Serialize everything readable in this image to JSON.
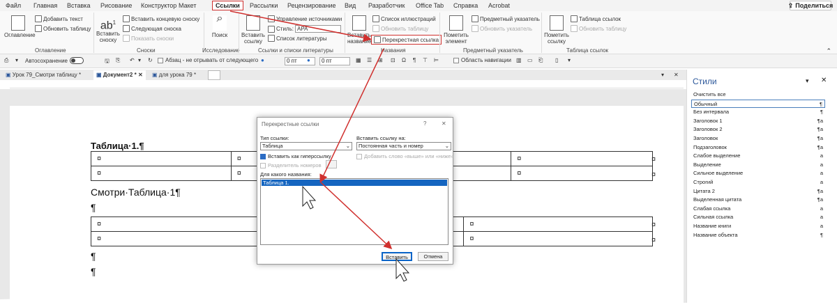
{
  "menu": {
    "tabs": [
      "Файл",
      "Главная",
      "Вставка",
      "Рисование",
      "Конструктор",
      "Макет",
      "Ссылки",
      "Рассылки",
      "Рецензирование",
      "Вид",
      "Разработчик",
      "Office Tab",
      "Справка",
      "Acrobat"
    ],
    "active_tab": "Ссылки",
    "share": "Поделиться"
  },
  "ribbon": {
    "toc": {
      "big": "Оглавление",
      "add_text": "Добавить текст",
      "update": "Обновить таблицу",
      "group": "Оглавление"
    },
    "footnotes": {
      "big1": "Вставить",
      "big2": "сноску",
      "insert_end": "Вставить концевую сноску",
      "next": "Следующая сноска",
      "show": "Показать сноски",
      "group": "Сноски",
      "ab": "ab",
      "sup": "1"
    },
    "research": {
      "big": "Поиск",
      "group": "Исследование"
    },
    "citations": {
      "big1": "Вставить",
      "big2": "ссылку",
      "manage": "Управление источниками",
      "style_label": "Стиль:",
      "style_value": "APA",
      "biblio": "Список литературы",
      "group": "Ссылки и списки литературы"
    },
    "captions": {
      "big1": "Вставить",
      "big2": "название",
      "list_fig": "Список иллюстраций",
      "update": "Обновить таблицу",
      "xref": "Перекрестная ссылка",
      "group": "Названия"
    },
    "index": {
      "big1": "Пометить",
      "big2": "элемент",
      "subject": "Предметный указатель",
      "update": "Обновить указатель",
      "group": "Предметный указатель"
    },
    "toa": {
      "big1": "Пометить",
      "big2": "ссылку",
      "table": "Таблица ссылок",
      "update": "Обновить таблицу",
      "group": "Таблица ссылок"
    }
  },
  "qat": {
    "autosave": "Автосохранение",
    "keep": "Абзац - не отрывать от следующего",
    "spin1": "0 пт",
    "spin2": "0 пт",
    "nav": "Область навигации"
  },
  "doc_tabs": [
    "Урок 79_Смотри таблицу *",
    "Документ2 *",
    "для урока 79 *"
  ],
  "document": {
    "caption": "Таблица·1.¶",
    "ref_line": "Смотри·Таблица·1¶",
    "para": "¶",
    "cell": "¤"
  },
  "styles": {
    "title": "Стили",
    "items": [
      {
        "name": "Очистить все",
        "mark": ""
      },
      {
        "name": "Обычный",
        "mark": "¶"
      },
      {
        "name": "Без интервала",
        "mark": "¶"
      },
      {
        "name": "Заголовок 1",
        "mark": "¶a"
      },
      {
        "name": "Заголовок 2",
        "mark": "¶a"
      },
      {
        "name": "Заголовок",
        "mark": "¶a"
      },
      {
        "name": "Подзаголовок",
        "mark": "¶a"
      },
      {
        "name": "Слабое выделение",
        "mark": "a"
      },
      {
        "name": "Выделение",
        "mark": "a"
      },
      {
        "name": "Сильное выделение",
        "mark": "a"
      },
      {
        "name": "Строгий",
        "mark": "a"
      },
      {
        "name": "Цитата 2",
        "mark": "¶a"
      },
      {
        "name": "Выделенная цитата",
        "mark": "¶a"
      },
      {
        "name": "Слабая ссылка",
        "mark": "a"
      },
      {
        "name": "Сильная ссылка",
        "mark": "a"
      },
      {
        "name": "Название книги",
        "mark": "a"
      },
      {
        "name": "Название объекта",
        "mark": "¶"
      }
    ],
    "selected": "Обычный"
  },
  "dialog": {
    "title": "Перекрестные ссылки",
    "type_label": "Тип ссылки:",
    "type_value": "Таблица",
    "insert_label": "Вставить ссылку на:",
    "insert_value": "Постоянная часть и номер",
    "hyperlink": "Вставить как гиперссылку",
    "above_below": "Добавить слово «выше» или «ниже»",
    "separator": "Разделитель номеров",
    "which_label": "Для какого названия:",
    "selected_item": "Таблица 1.",
    "insert_button": "Вставить",
    "cancel_button": "Отмена",
    "help": "?",
    "close": "✕"
  },
  "colors": {
    "accent_red": "#d0302e",
    "selection_blue": "#1565c0"
  }
}
